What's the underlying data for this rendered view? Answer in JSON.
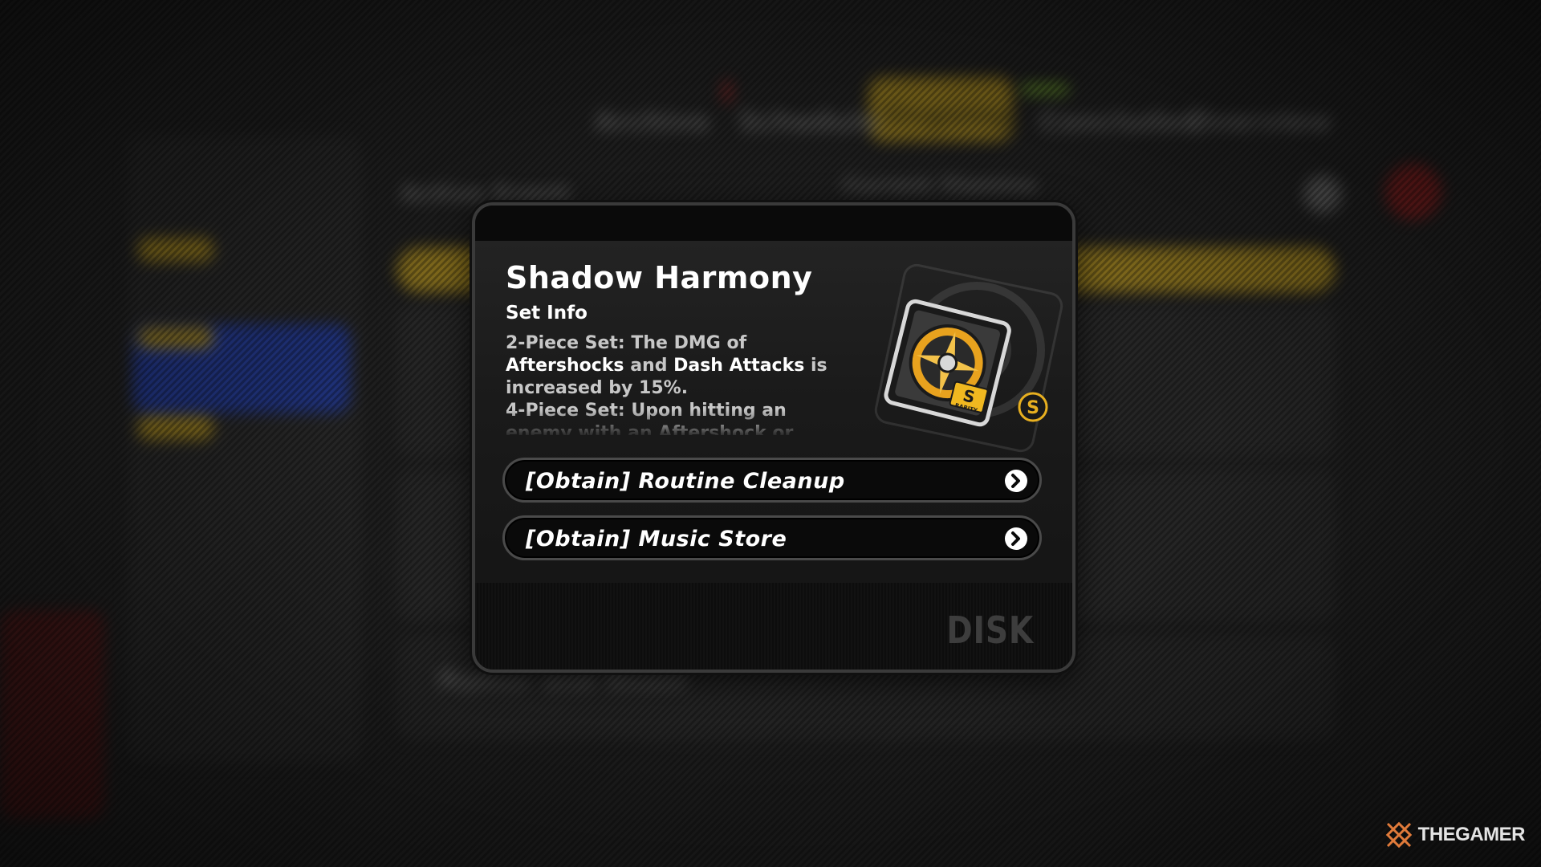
{
  "background": {
    "tabs": [
      "Archive",
      "Schedule",
      "Ongoing",
      "Concluded",
      "Overview"
    ],
    "section_title": "Active Event",
    "status_label": "Current Stamina",
    "list_item": "Rumor and Beast"
  },
  "popup": {
    "title": "Shadow Harmony",
    "subtitle": "Set Info",
    "description": {
      "line1_a": "2-Piece Set: The DMG of",
      "line2_hl1": "Aftershocks",
      "line2_mid": " and ",
      "line2_hl2": "Dash Attacks",
      "line2_end": " is",
      "line3": "increased by 15%.",
      "line4": "4-Piece Set: Upon hitting an",
      "line5_a": "enemy with an ",
      "line5_hl": "Aftershock",
      "line5_b": " or"
    },
    "disc_rarity": "S",
    "disc_rarity_label": "RARITY",
    "obtain_options": [
      {
        "label": "[Obtain] Routine Cleanup"
      },
      {
        "label": "[Obtain] Music Store"
      }
    ],
    "footer_label": "DISK"
  },
  "watermark": {
    "text": "THEGAMER",
    "color": "#e07a3a"
  },
  "colors": {
    "accent_yellow": "#e8b020",
    "highlight_blue": "#1f3fbf",
    "popup_bg": "#0c0c0c"
  }
}
